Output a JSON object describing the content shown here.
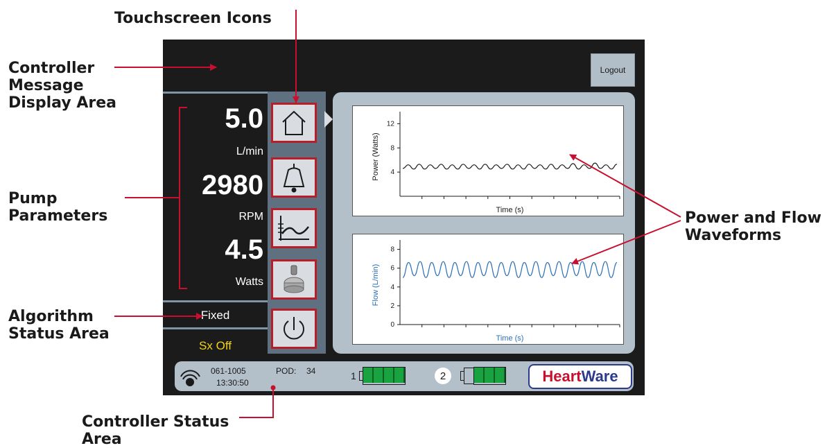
{
  "callouts": {
    "touchscreen_icons": "Touchscreen Icons",
    "message_area": [
      "Controller",
      "Message",
      "Display Area"
    ],
    "pump_params": [
      "Pump",
      "Parameters"
    ],
    "algorithm": [
      "Algorithm",
      "Status Area"
    ],
    "controller_status": [
      "Controller Status",
      "Area"
    ],
    "waveforms": [
      "Power and Flow",
      "Waveforms"
    ]
  },
  "header": {
    "logout_label": "Logout"
  },
  "pump": {
    "flow_value": "5.0",
    "flow_unit": "L/min",
    "speed_value": "2980",
    "speed_unit": "RPM",
    "power_value": "4.5",
    "power_unit": "Watts"
  },
  "algorithm_status": "Fixed",
  "suction_status": "Sx Off",
  "icons": [
    "home-icon",
    "alarm-bell-icon",
    "waveform-icon",
    "pump-icon",
    "power-icon"
  ],
  "status_bar": {
    "serial": "061-1005",
    "time": "13:30:50",
    "pod_label": "POD:",
    "pod_value": "34",
    "battery1_label": "1",
    "battery2_label": "2",
    "battery1_cells": 4,
    "battery2_cells": 3,
    "brand_heart": "Heart",
    "brand_ware": "Ware"
  },
  "chart_data": [
    {
      "type": "line",
      "title": "",
      "xlabel": "Time (s)",
      "ylabel": "Power (Watts)",
      "ylim": [
        0,
        14
      ],
      "yticks": [
        4,
        8,
        12
      ],
      "series": [
        {
          "values": [
            4.6,
            5.2,
            4.5,
            5.3,
            4.5,
            5.2,
            4.6,
            5.3,
            4.5,
            5.2,
            4.5,
            5.3,
            4.6,
            5.2,
            4.5,
            5.3,
            4.5,
            5.2,
            4.6,
            5.3,
            4.5,
            5.2,
            4.5,
            5.3,
            4.6,
            5.2,
            4.5,
            5.3,
            4.5,
            5.2,
            4.6,
            5.4,
            4.5,
            5.2,
            4.6,
            5.5,
            4.6,
            5.2,
            4.5,
            5.3
          ]
        }
      ],
      "color": "#1a1a1a"
    },
    {
      "type": "line",
      "title": "",
      "xlabel": "Time (s)",
      "ylabel": "Flow (L/min)",
      "ylim": [
        0,
        9
      ],
      "yticks": [
        0,
        2,
        4,
        6,
        8
      ],
      "series": [
        {
          "values": [
            5.0,
            6.6,
            5.2,
            6.7,
            5.0,
            6.6,
            5.2,
            6.7,
            5.0,
            6.6,
            5.2,
            6.7,
            5.0,
            6.6,
            5.2,
            6.7,
            5.0,
            6.6,
            5.2,
            6.7,
            5.0,
            6.6,
            5.2,
            6.7,
            5.0,
            6.6,
            5.2,
            6.7,
            5.0,
            6.6,
            5.2,
            6.7,
            5.0,
            6.6,
            5.2,
            6.7,
            5.0,
            6.6
          ]
        }
      ],
      "color": "#2a6fb8"
    }
  ],
  "colors": {
    "accent_red": "#c8102e",
    "screen_bg": "#1b1b1b",
    "panel": "#b3c0ca",
    "flow_blue": "#2a6fb8",
    "suction_yellow": "#f2d21b"
  }
}
